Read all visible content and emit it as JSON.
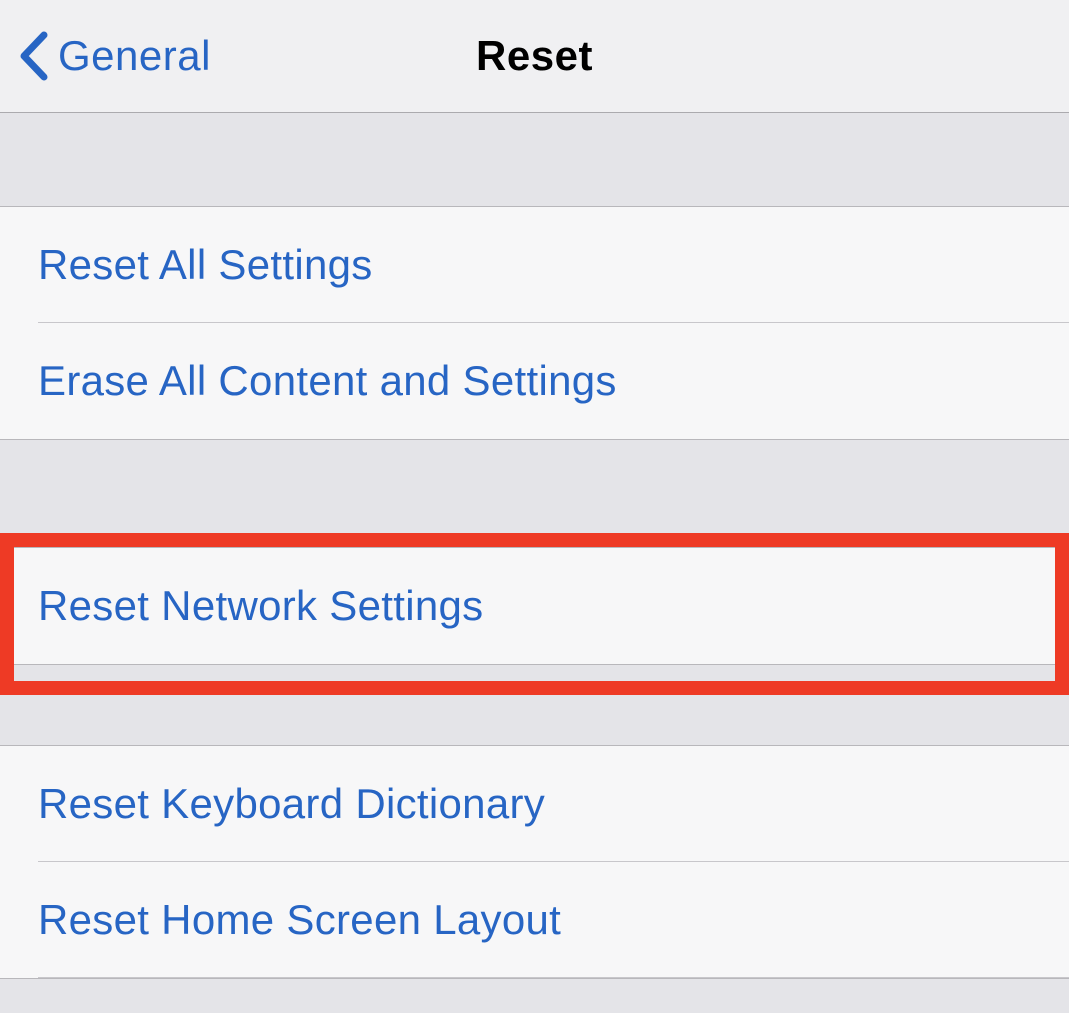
{
  "nav": {
    "back_label": "General",
    "title": "Reset"
  },
  "sections": {
    "group1": {
      "items": [
        {
          "label": "Reset All Settings"
        },
        {
          "label": "Erase All Content and Settings"
        }
      ]
    },
    "group2": {
      "items": [
        {
          "label": "Reset Network Settings"
        }
      ]
    },
    "group3": {
      "items": [
        {
          "label": "Reset Keyboard Dictionary"
        },
        {
          "label": "Reset Home Screen Layout"
        }
      ]
    }
  },
  "colors": {
    "link": "#2765c4",
    "highlight": "#ee3a25",
    "background": "#e4e4e8",
    "row_background": "#f7f7f8"
  }
}
